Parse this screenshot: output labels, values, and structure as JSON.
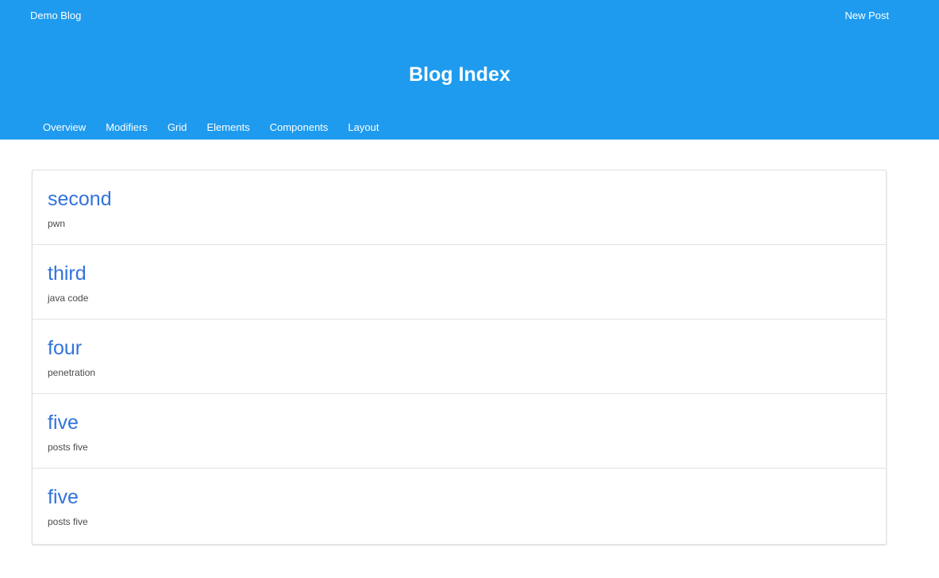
{
  "navbar": {
    "brand": "Demo Blog",
    "new_post": "New Post"
  },
  "hero": {
    "title": "Blog Index"
  },
  "tabs": [
    "Overview",
    "Modifiers",
    "Grid",
    "Elements",
    "Components",
    "Layout"
  ],
  "posts": [
    {
      "title": "second",
      "body": "pwn"
    },
    {
      "title": "third",
      "body": "java code"
    },
    {
      "title": "four",
      "body": "penetration"
    },
    {
      "title": "five",
      "body": "posts five"
    },
    {
      "title": "five",
      "body": "posts five"
    }
  ],
  "colors": {
    "hero_background": "#1e9bef",
    "link": "#3273dc",
    "text": "#4a4a4a"
  }
}
